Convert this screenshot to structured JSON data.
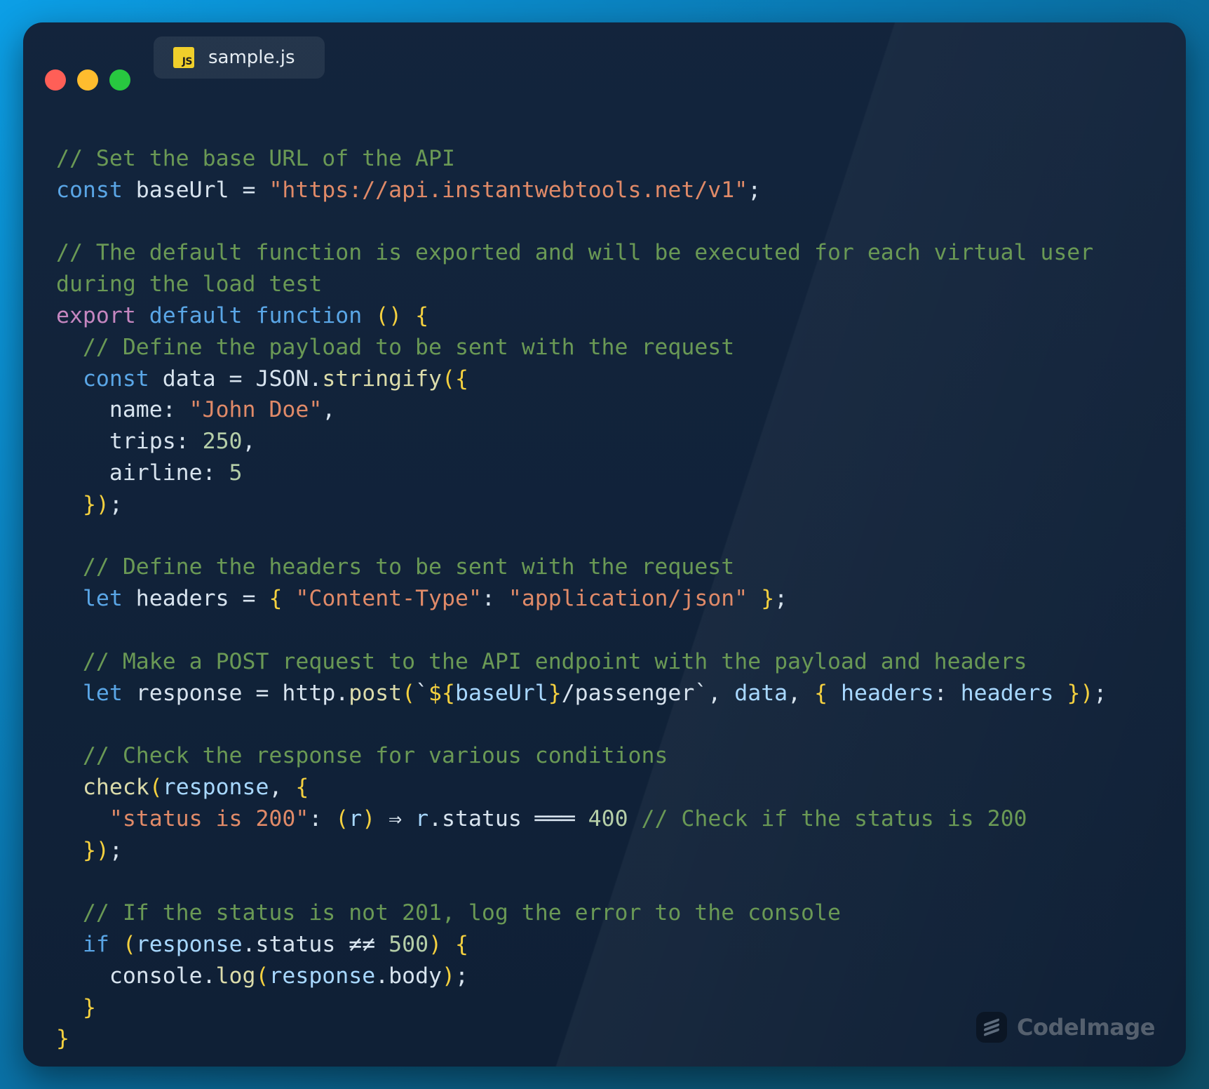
{
  "window": {
    "tab": {
      "label": "sample.js",
      "icon": "js-file-icon",
      "icon_text": "JS"
    },
    "controls": [
      "close",
      "minimize",
      "maximize"
    ]
  },
  "code": {
    "language": "javascript",
    "lines": [
      [
        {
          "t": "// Set the base URL of the API",
          "c": "com"
        }
      ],
      [
        {
          "t": "const",
          "c": "kw"
        },
        {
          "t": " baseUrl = ",
          "c": "pl"
        },
        {
          "t": "\"https://api.instantwebtools.net/v1\"",
          "c": "str"
        },
        {
          "t": ";",
          "c": "pl"
        }
      ],
      [],
      [
        {
          "t": "// The default function is exported and will be executed for each virtual user",
          "c": "com"
        }
      ],
      [
        {
          "t": "during the load test",
          "c": "com"
        }
      ],
      [
        {
          "t": "export",
          "c": "kw2"
        },
        {
          "t": " ",
          "c": "pl"
        },
        {
          "t": "default",
          "c": "kw"
        },
        {
          "t": " ",
          "c": "pl"
        },
        {
          "t": "function",
          "c": "kw"
        },
        {
          "t": " ",
          "c": "pl"
        },
        {
          "t": "()",
          "c": "br"
        },
        {
          "t": " ",
          "c": "pl"
        },
        {
          "t": "{",
          "c": "br"
        }
      ],
      [
        {
          "t": "  // Define the payload to be sent with the request",
          "c": "com"
        }
      ],
      [
        {
          "t": "  ",
          "c": "pl"
        },
        {
          "t": "const",
          "c": "kw"
        },
        {
          "t": " data = JSON.",
          "c": "pl"
        },
        {
          "t": "stringify",
          "c": "fn"
        },
        {
          "t": "({",
          "c": "br"
        }
      ],
      [
        {
          "t": "    name: ",
          "c": "pl"
        },
        {
          "t": "\"John Doe\"",
          "c": "str"
        },
        {
          "t": ",",
          "c": "pl"
        }
      ],
      [
        {
          "t": "    trips: ",
          "c": "pl"
        },
        {
          "t": "250",
          "c": "num"
        },
        {
          "t": ",",
          "c": "pl"
        }
      ],
      [
        {
          "t": "    airline: ",
          "c": "pl"
        },
        {
          "t": "5",
          "c": "num"
        }
      ],
      [
        {
          "t": "  ",
          "c": "pl"
        },
        {
          "t": "})",
          "c": "br"
        },
        {
          "t": ";",
          "c": "pl"
        }
      ],
      [],
      [
        {
          "t": "  // Define the headers to be sent with the request",
          "c": "com"
        }
      ],
      [
        {
          "t": "  ",
          "c": "pl"
        },
        {
          "t": "let",
          "c": "kw"
        },
        {
          "t": " headers = ",
          "c": "pl"
        },
        {
          "t": "{",
          "c": "br"
        },
        {
          "t": " ",
          "c": "pl"
        },
        {
          "t": "\"Content-Type\"",
          "c": "str"
        },
        {
          "t": ": ",
          "c": "pl"
        },
        {
          "t": "\"application/json\"",
          "c": "str"
        },
        {
          "t": " ",
          "c": "pl"
        },
        {
          "t": "}",
          "c": "br"
        },
        {
          "t": ";",
          "c": "pl"
        }
      ],
      [],
      [
        {
          "t": "  // Make a POST request to the API endpoint with the payload and headers",
          "c": "com"
        }
      ],
      [
        {
          "t": "  ",
          "c": "pl"
        },
        {
          "t": "let",
          "c": "kw"
        },
        {
          "t": " response = http.",
          "c": "pl"
        },
        {
          "t": "post",
          "c": "fn"
        },
        {
          "t": "(",
          "c": "br"
        },
        {
          "t": "`",
          "c": "pl"
        },
        {
          "t": "${",
          "c": "br"
        },
        {
          "t": "baseUrl",
          "c": "var"
        },
        {
          "t": "}",
          "c": "br"
        },
        {
          "t": "/passenger`",
          "c": "pl"
        },
        {
          "t": ", ",
          "c": "pl"
        },
        {
          "t": "data",
          "c": "var"
        },
        {
          "t": ", ",
          "c": "pl"
        },
        {
          "t": "{",
          "c": "br"
        },
        {
          "t": " headers",
          "c": "prop"
        },
        {
          "t": ": ",
          "c": "pl"
        },
        {
          "t": "headers",
          "c": "var"
        },
        {
          "t": " ",
          "c": "pl"
        },
        {
          "t": "})",
          "c": "br"
        },
        {
          "t": ";",
          "c": "pl"
        }
      ],
      [],
      [
        {
          "t": "  // Check the response for various conditions",
          "c": "com"
        }
      ],
      [
        {
          "t": "  ",
          "c": "pl"
        },
        {
          "t": "check",
          "c": "fn"
        },
        {
          "t": "(",
          "c": "br"
        },
        {
          "t": "response",
          "c": "var"
        },
        {
          "t": ", ",
          "c": "pl"
        },
        {
          "t": "{",
          "c": "br"
        }
      ],
      [
        {
          "t": "    ",
          "c": "pl"
        },
        {
          "t": "\"status is 200\"",
          "c": "str"
        },
        {
          "t": ": ",
          "c": "pl"
        },
        {
          "t": "(",
          "c": "br"
        },
        {
          "t": "r",
          "c": "var"
        },
        {
          "t": ")",
          "c": "br"
        },
        {
          "t": " ⇒ ",
          "c": "pl"
        },
        {
          "t": "r",
          "c": "var"
        },
        {
          "t": ".status ",
          "c": "pl"
        },
        {
          "t": "═══",
          "c": "pl"
        },
        {
          "t": " ",
          "c": "pl"
        },
        {
          "t": "400",
          "c": "num"
        },
        {
          "t": " // Check if the status is 200",
          "c": "com"
        }
      ],
      [
        {
          "t": "  ",
          "c": "pl"
        },
        {
          "t": "})",
          "c": "br"
        },
        {
          "t": ";",
          "c": "pl"
        }
      ],
      [],
      [
        {
          "t": "  // If the status is not 201, log the error to the console",
          "c": "com"
        }
      ],
      [
        {
          "t": "  ",
          "c": "pl"
        },
        {
          "t": "if",
          "c": "kw"
        },
        {
          "t": " ",
          "c": "pl"
        },
        {
          "t": "(",
          "c": "br"
        },
        {
          "t": "response",
          "c": "var"
        },
        {
          "t": ".status ",
          "c": "pl"
        },
        {
          "t": "≠≠",
          "c": "pl"
        },
        {
          "t": " ",
          "c": "pl"
        },
        {
          "t": "500",
          "c": "num"
        },
        {
          "t": ")",
          "c": "br"
        },
        {
          "t": " ",
          "c": "pl"
        },
        {
          "t": "{",
          "c": "br"
        }
      ],
      [
        {
          "t": "    console.",
          "c": "pl"
        },
        {
          "t": "log",
          "c": "fn"
        },
        {
          "t": "(",
          "c": "br"
        },
        {
          "t": "response",
          "c": "var"
        },
        {
          "t": ".body",
          "c": "pl"
        },
        {
          "t": ")",
          "c": "br"
        },
        {
          "t": ";",
          "c": "pl"
        }
      ],
      [
        {
          "t": "  ",
          "c": "pl"
        },
        {
          "t": "}",
          "c": "br"
        }
      ],
      [
        {
          "t": "}",
          "c": "br"
        }
      ]
    ]
  },
  "watermark": {
    "label": "CodeImage",
    "icon": "codeimage-logo-icon"
  },
  "colors": {
    "comment": "#6a9955",
    "keyword": "#5aa6e6",
    "export_keyword": "#c586c0",
    "string": "#e08a68",
    "number": "#b5cea8",
    "function": "#dcdcaa",
    "bracket": "#f4d03f",
    "plain": "#d7e3ee",
    "background": "#0f2036"
  }
}
